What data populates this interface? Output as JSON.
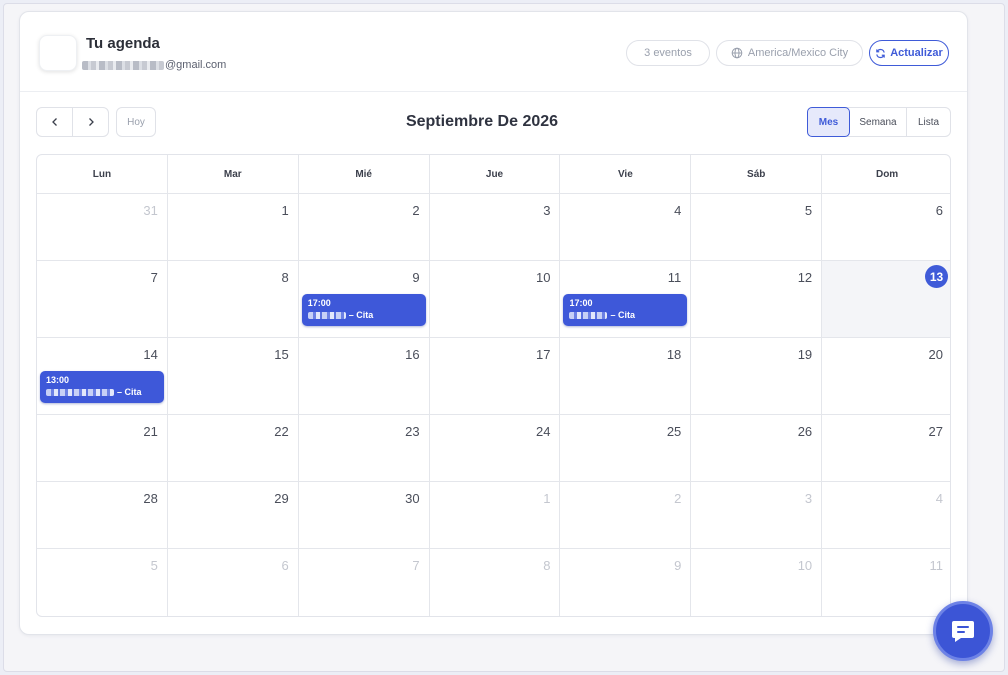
{
  "header": {
    "title": "Tu agenda",
    "email": "@gmail.com",
    "events_count": "3 eventos",
    "timezone": "America/Mexico City",
    "refresh_label": "Actualizar"
  },
  "toolbar": {
    "prev_icon": "chevron-left-icon",
    "next_icon": "chevron-right-icon",
    "today_label": "Hoy",
    "month_title": "Septiembre De 2026",
    "views": {
      "month": "Mes",
      "week": "Semana",
      "list": "Lista"
    },
    "active_view": "Mes"
  },
  "calendar": {
    "weekdays": [
      "Lun",
      "Mar",
      "Mié",
      "Jue",
      "Vie",
      "Sáb",
      "Dom"
    ],
    "weeks": [
      [
        {
          "d": "31",
          "out": true
        },
        {
          "d": "1"
        },
        {
          "d": "2"
        },
        {
          "d": "3"
        },
        {
          "d": "4"
        },
        {
          "d": "5"
        },
        {
          "d": "6"
        }
      ],
      [
        {
          "d": "7"
        },
        {
          "d": "8"
        },
        {
          "d": "9"
        },
        {
          "d": "10"
        },
        {
          "d": "11"
        },
        {
          "d": "12"
        },
        {
          "d": "13",
          "today": true
        }
      ],
      [
        {
          "d": "14"
        },
        {
          "d": "15"
        },
        {
          "d": "16"
        },
        {
          "d": "17"
        },
        {
          "d": "18"
        },
        {
          "d": "19"
        },
        {
          "d": "20"
        }
      ],
      [
        {
          "d": "21"
        },
        {
          "d": "22"
        },
        {
          "d": "23"
        },
        {
          "d": "24"
        },
        {
          "d": "25"
        },
        {
          "d": "26"
        },
        {
          "d": "27"
        }
      ],
      [
        {
          "d": "28"
        },
        {
          "d": "29"
        },
        {
          "d": "30"
        },
        {
          "d": "1",
          "out": true
        },
        {
          "d": "2",
          "out": true
        },
        {
          "d": "3",
          "out": true
        },
        {
          "d": "4",
          "out": true
        }
      ],
      [
        {
          "d": "5",
          "out": true
        },
        {
          "d": "6",
          "out": true
        },
        {
          "d": "7",
          "out": true
        },
        {
          "d": "8",
          "out": true
        },
        {
          "d": "9",
          "out": true
        },
        {
          "d": "10",
          "out": true
        },
        {
          "d": "11",
          "out": true
        }
      ]
    ],
    "events": [
      {
        "week": 1,
        "day": 2,
        "time": "17:00",
        "label": "– Cita"
      },
      {
        "week": 1,
        "day": 4,
        "time": "17:00",
        "label": "– Cita"
      },
      {
        "week": 2,
        "day": 0,
        "time": "13:00",
        "label": "– Cita"
      }
    ]
  },
  "colors": {
    "accent": "#3f5bd8",
    "event_bg": "#3e58d9",
    "today_bg": "#f4f5f8"
  },
  "chat_button_icon": "chat-icon"
}
